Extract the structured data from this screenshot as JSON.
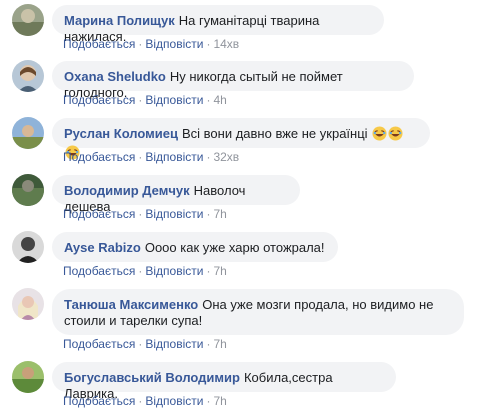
{
  "actions": {
    "like": "Подобається",
    "reply": "Відповісти",
    "separator": "·"
  },
  "comments": [
    {
      "author": "Марина Полищук",
      "text": "На гуманітарці тварина нажилася.",
      "time": "14хв"
    },
    {
      "author": "Oxana Sheludko",
      "text": "Ну никогда сытый не поймет голодного.",
      "time": "4h"
    },
    {
      "author": "Руслан Коломиец",
      "text": "Всі вони давно вже не українці",
      "emoji": [
        "😂",
        "😂",
        "😂"
      ],
      "time": "32хв"
    },
    {
      "author": "Володимир Демчук",
      "text": "Наволоч дешева",
      "time": "7h"
    },
    {
      "author": "Ayse Rabizo",
      "text": "Оооо как уже харю отожрала!",
      "time": "7h"
    },
    {
      "author": "Танюша Максименко",
      "text_line1": "Она уже мозги продала, но видимо не",
      "text_line2": "стоили и тарелки супа!",
      "time": "7h"
    },
    {
      "author": "Богуславський Володимир",
      "text": "Кобила,сестра Лаврика.",
      "time": "7h"
    }
  ],
  "colors": {
    "link": "#385898",
    "meta": "#90949c",
    "bubble": "#f2f3f5",
    "text": "#1c1e21"
  }
}
